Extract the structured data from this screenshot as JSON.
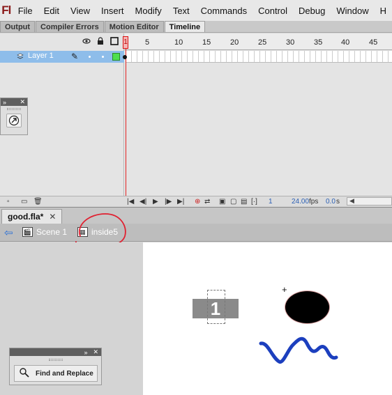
{
  "app": {
    "logo": "Fl"
  },
  "menu": [
    "File",
    "Edit",
    "View",
    "Insert",
    "Modify",
    "Text",
    "Commands",
    "Control",
    "Debug",
    "Window",
    "H"
  ],
  "panel_tabs": [
    "Output",
    "Compiler Errors",
    "Motion Editor",
    "Timeline"
  ],
  "active_panel_tab": "Timeline",
  "timeline": {
    "header_icons": [
      "eye-icon",
      "lock-icon",
      "outline-square-icon"
    ],
    "ruler": {
      "current_frame": "1",
      "labels": [
        "5",
        "10",
        "15",
        "20",
        "25",
        "30",
        "35",
        "40",
        "45"
      ]
    },
    "layer": {
      "name": "Layer 1",
      "color": "#4fdf4f"
    },
    "status": {
      "frame": "1",
      "fps": "24.00",
      "fps_unit": "fps",
      "time": "0.0",
      "time_unit": "s"
    }
  },
  "tools_panel": {
    "tool_icon": "subselection-arrow-icon"
  },
  "document": {
    "tab": "good.fla*",
    "breadcrumb": [
      {
        "label": "Scene 1",
        "icon": "scene-clapper-icon"
      },
      {
        "label": "inside5",
        "icon": "symbol-icon"
      }
    ]
  },
  "stage": {
    "symbol_text": "1",
    "ellipse_color": "#000000",
    "squiggle_color": "#1c3fbe",
    "annotation_color": "#e02030"
  },
  "find_panel": {
    "button_label": "Find and Replace"
  }
}
